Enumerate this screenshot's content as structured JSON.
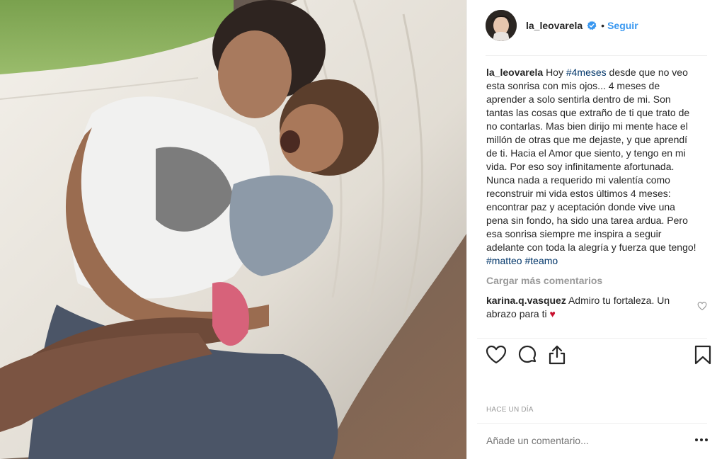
{
  "post": {
    "username": "la_leovarela",
    "follow_label": "Seguir",
    "separator": "•",
    "caption_user": "la_leovarela",
    "caption_parts": [
      {
        "text": "Hoy ",
        "tag": false
      },
      {
        "text": "#4meses",
        "tag": true
      },
      {
        "text": " desde que no veo esta sonrisa con mis ojos... 4 meses de aprender a solo sentirla dentro de mi. Son tantas las cosas que extraño de ti que trato de no contarlas. Mas bien dirijo mi mente hace el millón de otras que me dejaste, y que aprendí de ti. Hacia el Amor que siento, y tengo en mi vida. Por eso soy infinitamente afortunada. Nunca nada a requerido mi valentía como reconstruir mi vida estos últimos 4 meses: encontrar paz y aceptación donde vive una pena sin fondo, ha sido una tarea ardua. Pero esa sonrisa siempre me inspira a seguir adelante con toda la alegría y fuerza que tengo! ",
        "tag": false
      },
      {
        "text": "#matteo",
        "tag": true
      },
      {
        "text": " ",
        "tag": false
      },
      {
        "text": "#teamo",
        "tag": true
      }
    ],
    "load_more_label": "Cargar más comentarios",
    "comment": {
      "user": "karina.q.vasquez",
      "text": "Admiro tu fortaleza. Un abrazo para ti",
      "emoji": "♥"
    },
    "timestamp": "Hace un día",
    "comment_placeholder": "Añade un comentario...",
    "more_options": "•••"
  },
  "colors": {
    "link_blue": "#3897f0",
    "hashtag": "#003569",
    "muted": "#999999",
    "text": "#262626",
    "heart_red": "#ed4956"
  },
  "icons": {
    "verified": "verified-badge-icon",
    "like": "heart-icon",
    "comment": "comment-icon",
    "share": "share-icon",
    "save": "bookmark-icon"
  }
}
